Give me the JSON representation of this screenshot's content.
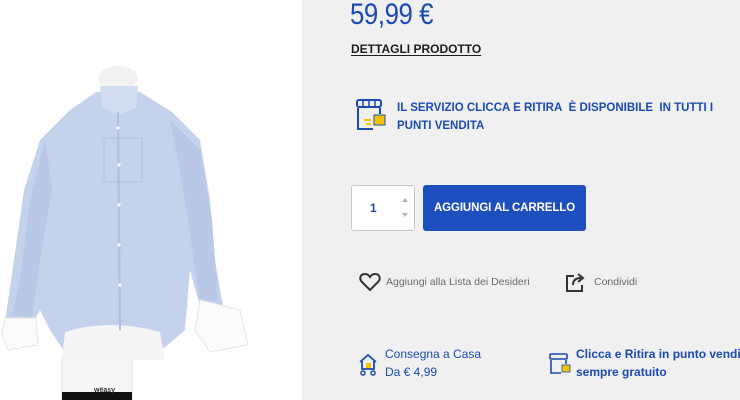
{
  "product": {
    "price": "59,99 €",
    "details_link": "DETTAGLI PRODOTTO",
    "image_brand": "wëasy"
  },
  "service": {
    "part1": "IL SERVIZIO CLICCA E RITIRA",
    "part2": "È DISPONIBILE",
    "part3": "IN TUTTI I PUNTI VENDITA",
    "icon": "store-box-icon"
  },
  "cart": {
    "quantity": "1",
    "add_label": "AGGIUNGI AL CARRELLO"
  },
  "actions": {
    "wishlist_label": "Aggiungi alla Lista dei Desideri",
    "share_label": "Condividi"
  },
  "shipping": {
    "home_title": "Consegna a Casa",
    "home_price": "Da € 4,99",
    "pickup_title": "Clicca e Ritira in punto vendita",
    "pickup_price": "sempre gratuito"
  },
  "colors": {
    "accent": "#1b4bb0",
    "button": "#1d4fbf",
    "background": "#f0f0f1"
  }
}
